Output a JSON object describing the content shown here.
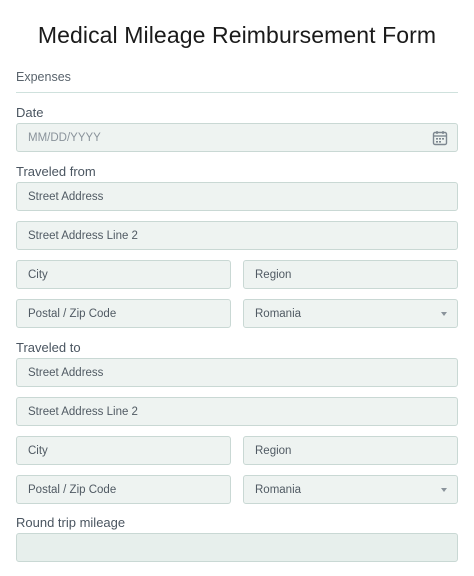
{
  "form": {
    "title": "Medical Mileage Reimbursement Form",
    "section": "Expenses"
  },
  "date": {
    "label": "Date",
    "placeholder": "MM/DD/YYYY",
    "icon": "calendar-icon"
  },
  "from": {
    "label": "Traveled from",
    "street": "Street Address",
    "street2": "Street Address Line 2",
    "city": "City",
    "region": "Region",
    "zip": "Postal / Zip Code",
    "country": "Romania"
  },
  "to": {
    "label": "Traveled to",
    "street": "Street Address",
    "street2": "Street Address Line 2",
    "city": "City",
    "region": "Region",
    "zip": "Postal / Zip Code",
    "country": "Romania"
  },
  "mileage": {
    "label": "Round trip mileage",
    "value": ""
  },
  "colors": {
    "field_bg": "#eef3f1",
    "field_border": "#c9d8d4",
    "divider": "#cfe1dd"
  }
}
